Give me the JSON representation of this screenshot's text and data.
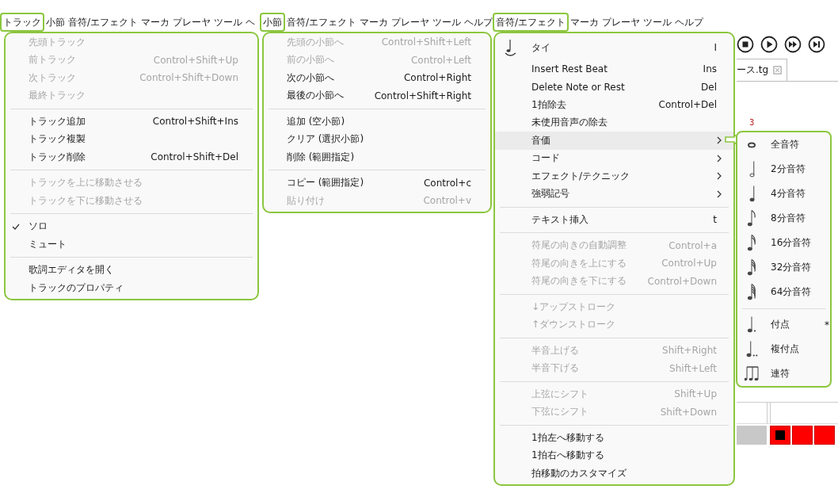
{
  "panels": [
    {
      "menubar": [
        {
          "label": "トラック",
          "selected": true
        },
        {
          "label": "小節",
          "selected": false
        },
        {
          "label": "音符/エフェクト",
          "selected": false
        },
        {
          "label": "マーカ",
          "selected": false
        },
        {
          "label": "プレーヤ",
          "selected": false
        },
        {
          "label": "ツール",
          "selected": false
        },
        {
          "label": "ヘ",
          "selected": false
        }
      ],
      "menu": {
        "groups": [
          [
            {
              "label": "先頭トラック",
              "disabled": true
            },
            {
              "label": "前トラック",
              "shortcut": "Control+Shift+Up",
              "disabled": true
            },
            {
              "label": "次トラック",
              "shortcut": "Control+Shift+Down",
              "disabled": true
            },
            {
              "label": "最終トラック",
              "disabled": true
            }
          ],
          [
            {
              "label": "トラック追加",
              "shortcut": "Control+Shift+Ins",
              "disabled": false
            },
            {
              "label": "トラック複製",
              "disabled": false
            },
            {
              "label": "トラック削除",
              "shortcut": "Control+Shift+Del",
              "disabled": false
            }
          ],
          [
            {
              "label": "トラックを上に移動させる",
              "disabled": true
            },
            {
              "label": "トラックを下に移動させる",
              "disabled": true
            }
          ],
          [
            {
              "label": "ソロ",
              "disabled": false,
              "checked": true
            },
            {
              "label": "ミュート",
              "disabled": false,
              "checked": false
            }
          ],
          [
            {
              "label": "歌詞エディタを開く",
              "disabled": false
            },
            {
              "label": "トラックのプロパティ",
              "disabled": false
            }
          ]
        ]
      }
    },
    {
      "menubar": [
        {
          "label": "小節",
          "selected": true
        },
        {
          "label": "音符/エフェクト",
          "selected": false
        },
        {
          "label": "マーカ",
          "selected": false
        },
        {
          "label": "プレーヤ",
          "selected": false
        },
        {
          "label": "ツール",
          "selected": false
        },
        {
          "label": "ヘルプ",
          "selected": false
        }
      ],
      "menu": {
        "groups": [
          [
            {
              "label": "先頭の小節へ",
              "shortcut": "Control+Shift+Left",
              "disabled": true
            },
            {
              "label": "前の小節へ",
              "shortcut": "Control+Left",
              "disabled": true
            },
            {
              "label": "次の小節へ",
              "shortcut": "Control+Right",
              "disabled": false
            },
            {
              "label": "最後の小節へ",
              "shortcut": "Control+Shift+Right",
              "disabled": false
            }
          ],
          [
            {
              "label": "追加 (空小節)",
              "disabled": false
            },
            {
              "label": "クリア (選択小節)",
              "disabled": false
            },
            {
              "label": "削除 (範囲指定)",
              "disabled": false
            }
          ],
          [
            {
              "label": "コピー (範囲指定)",
              "shortcut": "Control+c",
              "disabled": false
            },
            {
              "label": "貼り付け",
              "shortcut": "Control+v",
              "disabled": true
            }
          ]
        ]
      }
    },
    {
      "menubar": [
        {
          "label": "音符/エフェクト",
          "selected": true
        },
        {
          "label": "マーカ",
          "selected": false
        },
        {
          "label": "プレーヤ",
          "selected": false
        },
        {
          "label": "ツール",
          "selected": false
        },
        {
          "label": "ヘルプ",
          "selected": false
        }
      ],
      "menu": {
        "groups": [
          [
            {
              "label": "タイ",
              "shortcut": "I",
              "disabled": false,
              "highlighted": false,
              "submenu": false
            },
            {
              "label": "Insert Rest Beat",
              "shortcut": "Ins",
              "disabled": false,
              "highlighted": false,
              "submenu": false
            },
            {
              "label": "Delete Note or Rest",
              "shortcut": "Del",
              "disabled": false,
              "highlighted": false,
              "submenu": false
            },
            {
              "label": "1拍除去",
              "shortcut": "Control+Del",
              "disabled": false,
              "highlighted": false,
              "submenu": false
            },
            {
              "label": "未使用音声の除去",
              "disabled": false,
              "highlighted": false,
              "submenu": false
            },
            {
              "label": "音価",
              "disabled": false,
              "highlighted": true,
              "submenu": true
            },
            {
              "label": "コード",
              "disabled": false,
              "highlighted": false,
              "submenu": true
            },
            {
              "label": "エフェクト/テクニック",
              "disabled": false,
              "highlighted": false,
              "submenu": true
            },
            {
              "label": "強弱記号",
              "disabled": false,
              "highlighted": false,
              "submenu": true
            }
          ],
          [
            {
              "label": "テキスト挿入",
              "shortcut": "t",
              "disabled": false,
              "highlighted": false,
              "submenu": false
            }
          ],
          [
            {
              "label": "符尾の向きの自動調整",
              "shortcut": "Control+a",
              "disabled": true,
              "highlighted": false,
              "submenu": false
            },
            {
              "label": "符尾の向きを上にする",
              "shortcut": "Control+Up",
              "disabled": true,
              "highlighted": false,
              "submenu": false
            },
            {
              "label": "符尾の向きを下にする",
              "shortcut": "Control+Down",
              "disabled": true,
              "highlighted": false,
              "submenu": false
            }
          ],
          [
            {
              "label": "↓アップストローク",
              "disabled": true,
              "highlighted": false,
              "submenu": false
            },
            {
              "label": "↑ダウンストローク",
              "disabled": true,
              "highlighted": false,
              "submenu": false
            }
          ],
          [
            {
              "label": "半音上げる",
              "shortcut": "Shift+Right",
              "disabled": true,
              "highlighted": false,
              "submenu": false
            },
            {
              "label": "半音下げる",
              "shortcut": "Shift+Left",
              "disabled": true,
              "highlighted": false,
              "submenu": false
            }
          ],
          [
            {
              "label": "上弦にシフト",
              "shortcut": "Shift+Up",
              "disabled": true,
              "highlighted": false,
              "submenu": false
            },
            {
              "label": "下弦にシフト",
              "shortcut": "Shift+Down",
              "disabled": true,
              "highlighted": false,
              "submenu": false
            }
          ],
          [
            {
              "label": "1拍左へ移動する",
              "disabled": false,
              "highlighted": false,
              "submenu": false
            },
            {
              "label": "1拍右へ移動する",
              "disabled": false,
              "highlighted": false,
              "submenu": false
            },
            {
              "label": "拍移動のカスタマイズ",
              "disabled": false,
              "highlighted": false,
              "submenu": false
            }
          ]
        ]
      },
      "submenu": {
        "groups": [
          [
            {
              "label": "全音符"
            },
            {
              "label": "2分音符"
            },
            {
              "label": "4分音符"
            },
            {
              "label": "8分音符"
            },
            {
              "label": "16分音符"
            },
            {
              "label": "32分音符"
            },
            {
              "label": "64分音符"
            }
          ],
          [
            {
              "label": "付点",
              "shortcut": "*"
            },
            {
              "label": "複付点"
            },
            {
              "label": "連符"
            }
          ]
        ]
      },
      "app": {
        "tab_label": "ース.tg",
        "measure_number": "3"
      }
    }
  ]
}
